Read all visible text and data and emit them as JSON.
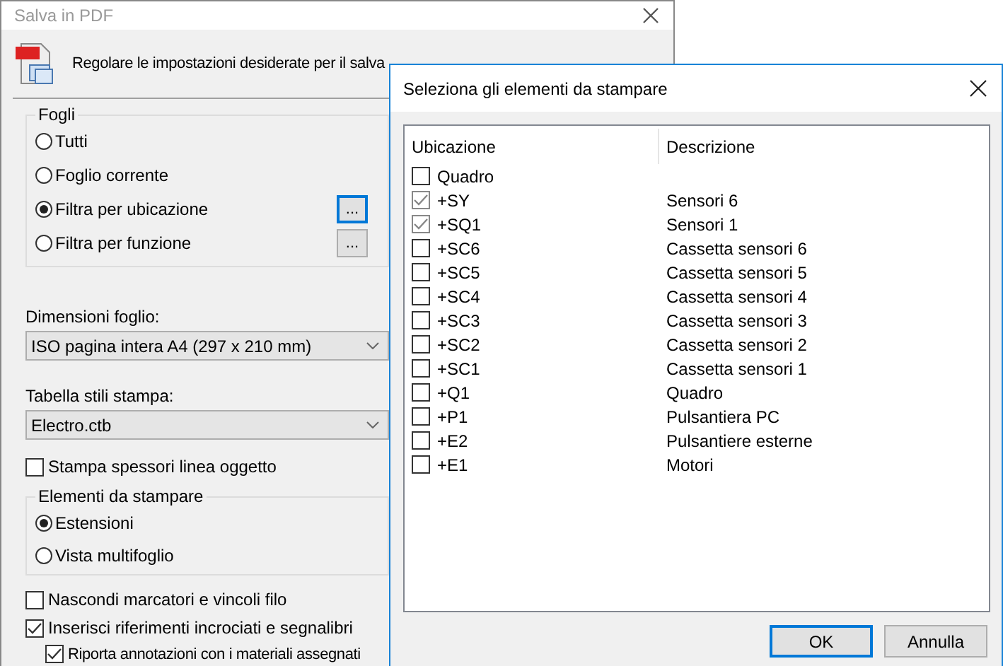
{
  "main_window": {
    "title": "Salva in PDF",
    "header_text": "Regolare le impostazioni desiderate per il salva",
    "sheets_group": {
      "label": "Fogli",
      "options": [
        {
          "label": "Tutti",
          "selected": false
        },
        {
          "label": "Foglio corrente",
          "selected": false
        },
        {
          "label": "Filtra per ubicazione",
          "selected": true,
          "button": {
            "label": "...",
            "focused": true
          }
        },
        {
          "label": "Filtra per funzione",
          "selected": false,
          "button": {
            "label": "...",
            "focused": false
          }
        }
      ]
    },
    "sheet_size": {
      "label": "Dimensioni foglio:",
      "value": "ISO pagina intera A4 (297 x 210 mm)"
    },
    "plot_style_table": {
      "label": "Tabella stili stampa:",
      "value": "Electro.ctb"
    },
    "lineweights": {
      "label": "Stampa spessori linea oggetto",
      "checked": false
    },
    "print_items_group": {
      "label": "Elementi da stampare",
      "options": [
        {
          "label": "Estensioni",
          "selected": true
        },
        {
          "label": "Vista multifoglio",
          "selected": false
        }
      ]
    },
    "options": [
      {
        "label": "Nascondi marcatori e vincoli filo",
        "checked": false
      },
      {
        "label": "Inserisci riferimenti incrociati e segnalibri",
        "checked": true,
        "children": [
          {
            "label": "Riporta annotazioni con i materiali assegnati",
            "checked": true
          }
        ]
      }
    ]
  },
  "dialog": {
    "title": "Seleziona gli elementi da stampare",
    "columns": [
      "Ubicazione",
      "Descrizione"
    ],
    "rows": [
      {
        "location": "Quadro",
        "checked": false
      },
      {
        "location": "+SY",
        "description": "Sensori 6",
        "checked": true
      },
      {
        "location": "+SQ1",
        "description": "Sensori 1",
        "checked": true
      },
      {
        "location": "+SC6",
        "description": "Cassetta sensori 6",
        "checked": false
      },
      {
        "location": "+SC5",
        "description": "Cassetta sensori 5",
        "checked": false
      },
      {
        "location": "+SC4",
        "description": "Cassetta sensori 4",
        "checked": false
      },
      {
        "location": "+SC3",
        "description": "Cassetta sensori 3",
        "checked": false
      },
      {
        "location": "+SC2",
        "description": "Cassetta sensori 2",
        "checked": false
      },
      {
        "location": "+SC1",
        "description": "Cassetta sensori 1",
        "checked": false
      },
      {
        "location": "+Q1",
        "description": "Quadro",
        "checked": false
      },
      {
        "location": "+P1",
        "description": "Pulsantiera PC",
        "checked": false
      },
      {
        "location": "+E2",
        "description": "Pulsantiere esterne",
        "checked": false
      },
      {
        "location": "+E1",
        "description": "Motori",
        "checked": false
      }
    ],
    "buttons": [
      {
        "label": "OK",
        "default": true
      },
      {
        "label": "Annulla",
        "default": false
      }
    ]
  }
}
